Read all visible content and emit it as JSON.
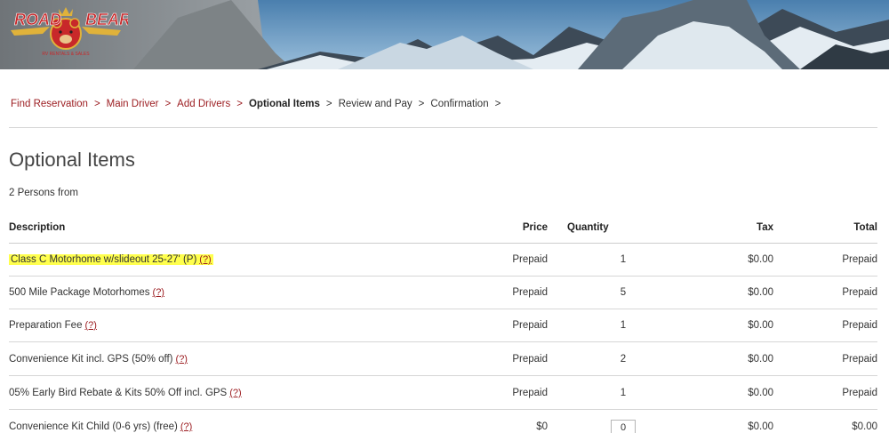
{
  "brand": {
    "logo_text_left": "ROAD",
    "logo_text_right": "BEAR",
    "logo_tagline": "RV RENTALS & SALES",
    "accent": "#9b1b1f"
  },
  "breadcrumb": [
    {
      "label": "Find Reservation",
      "state": "link"
    },
    {
      "label": "Main Driver",
      "state": "link"
    },
    {
      "label": "Add Drivers",
      "state": "link"
    },
    {
      "label": "Optional Items",
      "state": "current"
    },
    {
      "label": "Review and Pay",
      "state": "plain"
    },
    {
      "label": "Confirmation",
      "state": "plain"
    }
  ],
  "separator": ">",
  "page": {
    "title": "Optional Items",
    "subtitle": "2 Persons from"
  },
  "table": {
    "headers": {
      "description": "Description",
      "price": "Price",
      "quantity": "Quantity",
      "tax": "Tax",
      "total": "Total"
    },
    "help_label": "(?)",
    "rows": [
      {
        "description": "Class C Motorhome w/slideout 25-27' (P)",
        "price": "Prepaid",
        "quantity": "1",
        "tax": "$0.00",
        "total": "Prepaid",
        "highlighted": true
      },
      {
        "description": "500 Mile Package Motorhomes",
        "price": "Prepaid",
        "quantity": "5",
        "tax": "$0.00",
        "total": "Prepaid"
      },
      {
        "description": "Preparation Fee",
        "price": "Prepaid",
        "quantity": "1",
        "tax": "$0.00",
        "total": "Prepaid"
      },
      {
        "description": "Convenience Kit incl. GPS (50% off)",
        "price": "Prepaid",
        "quantity": "2",
        "tax": "$0.00",
        "total": "Prepaid"
      },
      {
        "description": "05% Early Bird Rebate & Kits 50% Off incl. GPS",
        "price": "Prepaid",
        "quantity": "1",
        "tax": "$0.00",
        "total": "Prepaid"
      },
      {
        "description": "Convenience Kit Child (0-6 yrs) (free)",
        "price": "$0",
        "quantity_input": "0",
        "tax": "$0.00",
        "total": "$0.00"
      }
    ]
  }
}
